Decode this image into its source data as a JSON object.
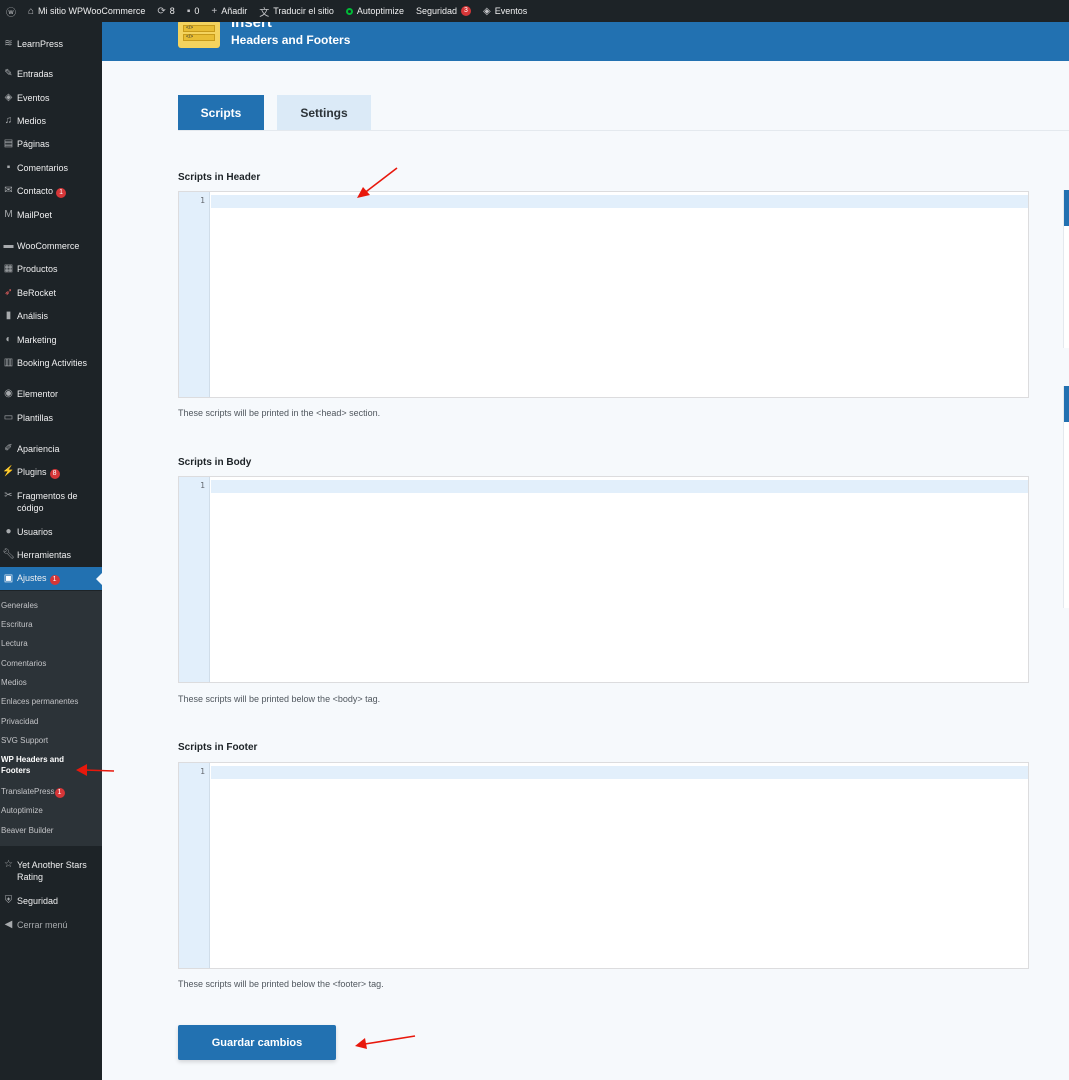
{
  "adminbar": {
    "site_name": "Mi sitio WPWooCommerce",
    "updates_count": "8",
    "comments_count": "0",
    "add_label": "Añadir",
    "translate_label": "Traducir el sitio",
    "autoptimize_label": "Autoptimize",
    "security_label": "Seguridad",
    "security_badge": "3",
    "events_label": "Eventos"
  },
  "sidebar": {
    "items": [
      {
        "label": "LearnPress",
        "icon": "learnpress-icon"
      },
      {
        "label": "Entradas",
        "icon": "pin-icon"
      },
      {
        "label": "Eventos",
        "icon": "events-icon"
      },
      {
        "label": "Medios",
        "icon": "media-icon"
      },
      {
        "label": "Páginas",
        "icon": "page-icon"
      },
      {
        "label": "Comentarios",
        "icon": "comment-icon"
      },
      {
        "label": "Contacto",
        "icon": "mail-icon",
        "badge": "1"
      },
      {
        "label": "MailPoet",
        "icon": "mailpoet-icon"
      },
      {
        "label": "WooCommerce",
        "icon": "woo-icon"
      },
      {
        "label": "Productos",
        "icon": "products-icon"
      },
      {
        "label": "BeRocket",
        "icon": "rocket-icon"
      },
      {
        "label": "Análisis",
        "icon": "chart-icon"
      },
      {
        "label": "Marketing",
        "icon": "megaphone-icon"
      },
      {
        "label": "Booking Activities",
        "icon": "calendar-icon"
      },
      {
        "label": "Elementor",
        "icon": "elementor-icon"
      },
      {
        "label": "Plantillas",
        "icon": "folder-icon"
      },
      {
        "label": "Apariencia",
        "icon": "brush-icon"
      },
      {
        "label": "Plugins",
        "icon": "plug-icon",
        "badge": "8"
      },
      {
        "label": "Fragmentos de código",
        "icon": "scissors-icon"
      },
      {
        "label": "Usuarios",
        "icon": "user-icon"
      },
      {
        "label": "Herramientas",
        "icon": "wrench-icon"
      },
      {
        "label": "Ajustes",
        "icon": "settings-icon",
        "badge": "1"
      },
      {
        "label": "Yet Another Stars Rating",
        "icon": "star-icon"
      },
      {
        "label": "Seguridad",
        "icon": "shield-icon"
      },
      {
        "label": "Cerrar menú",
        "icon": "collapse-icon"
      }
    ],
    "submenu": [
      {
        "label": "Generales"
      },
      {
        "label": "Escritura"
      },
      {
        "label": "Lectura"
      },
      {
        "label": "Comentarios"
      },
      {
        "label": "Medios"
      },
      {
        "label": "Enlaces permanentes"
      },
      {
        "label": "Privacidad"
      },
      {
        "label": "SVG Support"
      },
      {
        "label": "WP Headers and Footers"
      },
      {
        "label": "TranslatePress",
        "badge": "1"
      },
      {
        "label": "Autoptimize"
      },
      {
        "label": "Beaver Builder"
      }
    ]
  },
  "banner": {
    "logo_text_1": "</>",
    "logo_text_2": "</>",
    "title": "Insert",
    "subtitle": "Headers and Footers"
  },
  "tabs": {
    "scripts": "Scripts",
    "settings": "Settings"
  },
  "sections": {
    "header": {
      "label": "Scripts in Header",
      "line": "1",
      "desc": "These scripts will be printed in the <head> section."
    },
    "body": {
      "label": "Scripts in Body",
      "line": "1",
      "desc": "These scripts will be printed below the <body> tag."
    },
    "footer": {
      "label": "Scripts in Footer",
      "line": "1",
      "desc": "These scripts will be printed below the <footer> tag."
    }
  },
  "save_label": "Guardar cambios",
  "colors": {
    "accent": "#2271b1",
    "sidebar": "#1d2327",
    "badge": "#d63638",
    "annotation": "#e8180c"
  }
}
